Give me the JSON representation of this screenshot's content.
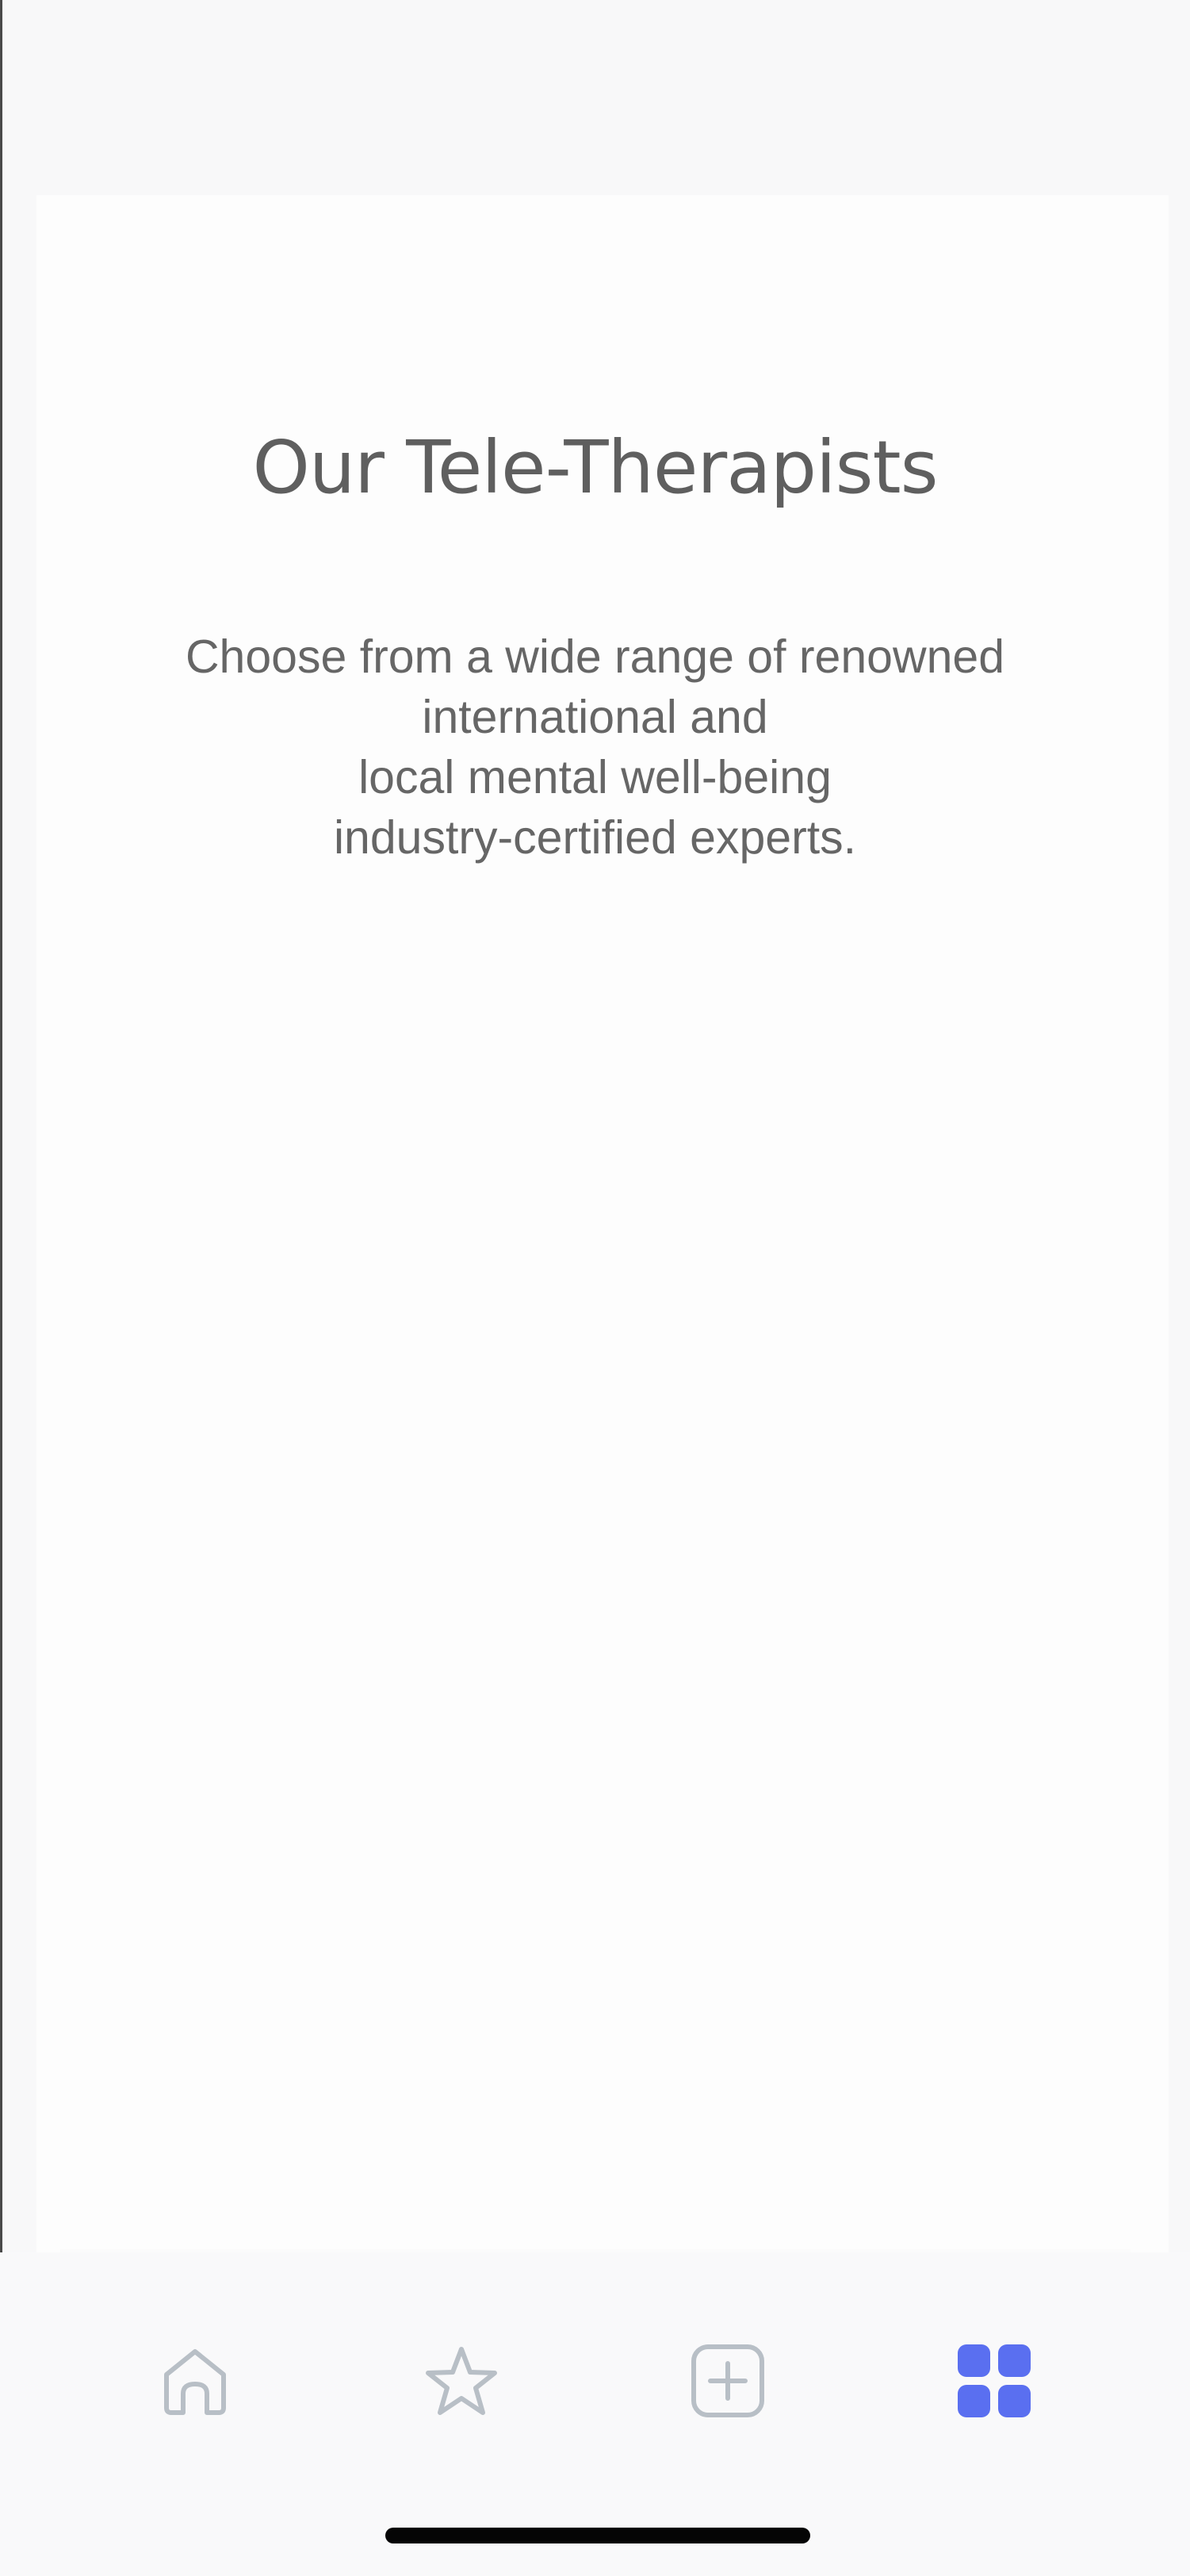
{
  "page": {
    "title": "Our Tele-Therapists",
    "subtitle_lines": [
      "Choose from a wide range of renowned",
      "international and",
      "local mental well-being",
      "industry-certified experts."
    ]
  },
  "bottom_nav": {
    "items": [
      {
        "icon": "home-icon",
        "active": false
      },
      {
        "icon": "star-icon",
        "active": false
      },
      {
        "icon": "plus-square-icon",
        "active": false
      },
      {
        "icon": "grid-icon",
        "active": true
      }
    ],
    "active_color": "#5a6ff0",
    "inactive_color": "#b8bfc6"
  }
}
